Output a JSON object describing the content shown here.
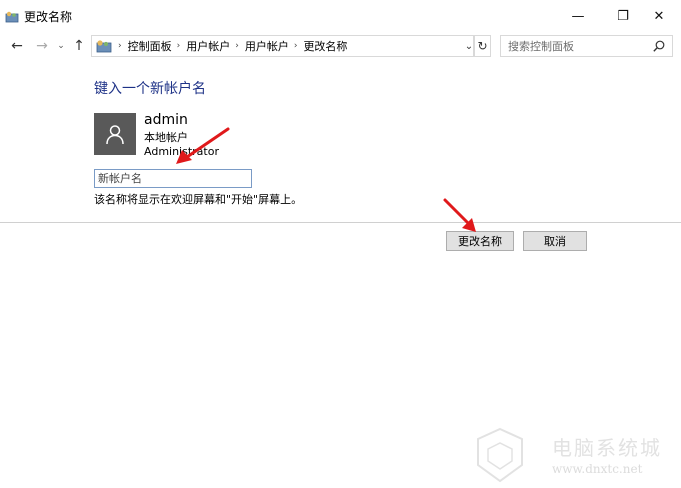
{
  "window": {
    "title": "更改名称",
    "minimize_glyph": "—",
    "maximize_glyph": "❐",
    "close_glyph": "✕"
  },
  "nav": {
    "back_glyph": "←",
    "forward_glyph": "→",
    "history_glyph": "⌄",
    "up_glyph": "↑"
  },
  "address": {
    "breadcrumbs": [
      "控制面板",
      "用户帐户",
      "用户帐户",
      "更改名称"
    ],
    "separator_glyph": "›",
    "dropdown_glyph": "⌄",
    "refresh_glyph": "↻"
  },
  "search": {
    "placeholder": "搜索控制面板",
    "value": ""
  },
  "content": {
    "heading": "键入一个新帐户名",
    "user": {
      "name": "admin",
      "type": "本地帐户",
      "role": "Administrator"
    },
    "name_input": {
      "placeholder": "新帐户名",
      "value": ""
    },
    "hint": "该名称将显示在欢迎屏幕和\"开始\"屏幕上。"
  },
  "buttons": {
    "rename": "更改名称",
    "cancel": "取消"
  },
  "annotations": {
    "arrow_color": "#e0191b"
  },
  "watermark": {
    "text": "电脑系统城",
    "url": "www.dnxtc.net"
  },
  "colors": {
    "heading": "#1e3287",
    "avatar_bg": "#595959",
    "input_border": "#7a9bc6",
    "button_bg": "#e1e1e1"
  }
}
